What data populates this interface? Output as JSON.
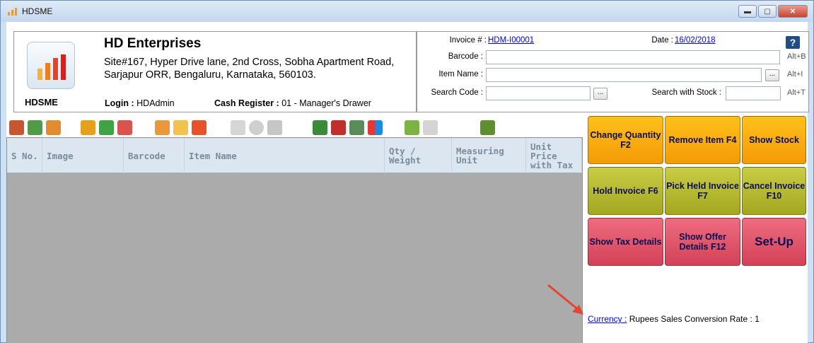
{
  "window": {
    "title": "HDSME"
  },
  "company": {
    "logo_text": "HDSME",
    "name": "HD Enterprises",
    "address": "Site#167, Hyper Drive lane, 2nd Cross, Sobha Apartment Road, Sarjapur ORR, Bengaluru, Karnataka, 560103.",
    "login_label": "Login :",
    "login_value": "HDAdmin",
    "cash_label": "Cash Register :",
    "cash_value": "01 - Manager's Drawer"
  },
  "invoice": {
    "invoice_label": "Invoice # :",
    "invoice_value": "HDM-I00001",
    "date_label": "Date :",
    "date_value": "16/02/2018",
    "help": "?",
    "barcode_label": "Barcode :",
    "barcode_hint": "Alt+B",
    "item_label": "Item Name :",
    "item_hint": "Alt+I",
    "search_label": "Search Code :",
    "search_stock_label": "Search with Stock :",
    "search_hint": "Alt+T",
    "dots": "..."
  },
  "grid": {
    "columns": [
      "S No.",
      "Image",
      "Barcode",
      "Item Name",
      "Qty / Weight",
      "Measuring Unit",
      "Unit Price with Tax"
    ]
  },
  "actions": {
    "change_qty": "Change Quantity F2",
    "remove_item": "Remove Item F4",
    "show_stock": "Show Stock",
    "hold_invoice": "Hold Invoice F6",
    "pick_held": "Pick Held Invoice F7",
    "cancel_invoice": "Cancel Invoice F10",
    "show_tax": "Show Tax Details",
    "show_offer": "Show Offer Details F12",
    "setup": "Set-Up"
  },
  "footer": {
    "currency_label": "Currency :",
    "currency_value": "Rupees",
    "rate_label": "Sales Conversion Rate :",
    "rate_value": "1"
  },
  "colors": {
    "orange": "#f5a80c",
    "olive": "#b4b833",
    "red": "#e0566a",
    "link": "#0000ee"
  }
}
